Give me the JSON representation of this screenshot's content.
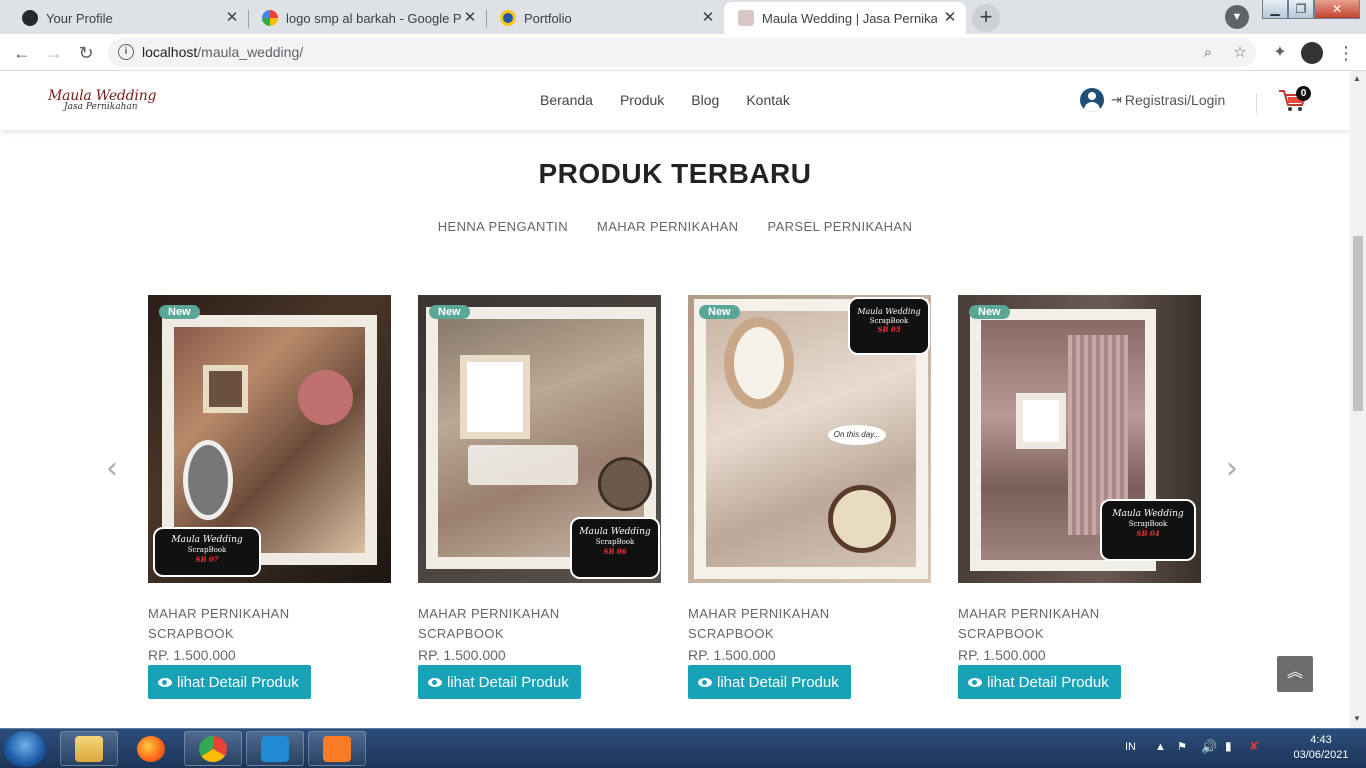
{
  "browser": {
    "tabs": [
      {
        "title": "Your Profile",
        "favicon": "github-icon",
        "color": "#24292e"
      },
      {
        "title": "logo smp al barkah - Google Pen",
        "favicon": "google-icon",
        "color": "#4285f4"
      },
      {
        "title": "Portfolio",
        "favicon": "portfolio-icon",
        "color": "#1e5aa8"
      },
      {
        "title": "Maula Wedding | Jasa Pernikahan",
        "favicon": "site-icon",
        "color": "#a0a0a0"
      }
    ],
    "address": {
      "host": "localhost",
      "path": "/maula_wedding/"
    }
  },
  "site": {
    "logo": {
      "line1": "Maula Wedding",
      "line2": "Jasa Pernikahan"
    },
    "nav": [
      "Beranda",
      "Produk",
      "Blog",
      "Kontak"
    ],
    "account_label": "Registrasi/Login",
    "cart_count": "0",
    "section_title": "PRODUK TERBARU",
    "filters": [
      "HENNA PENGANTIN",
      "MAHAR PERNIKAHAN",
      "PARSEL PERNIKAHAN"
    ],
    "products": [
      {
        "badge": "New",
        "category": "MAHAR PERNIKAHAN",
        "name": "SCRAPBOOK",
        "price": "RP. 1.500.000",
        "button": "lihat Detail Produk",
        "tag": "SB 07"
      },
      {
        "badge": "New",
        "category": "MAHAR PERNIKAHAN",
        "name": "SCRAPBOOK",
        "price": "RP. 1.500.000",
        "button": "lihat Detail Produk",
        "tag": "SB 06"
      },
      {
        "badge": "New",
        "category": "MAHAR PERNIKAHAN",
        "name": "SCRAPBOOK",
        "price": "RP. 1.500.000",
        "button": "lihat Detail Produk",
        "tag": "SB 05"
      },
      {
        "badge": "New",
        "category": "MAHAR PERNIKAHAN",
        "name": "SCRAPBOOK",
        "price": "RP. 1.500.000",
        "button": "lihat Detail Produk",
        "tag": "SB 04"
      }
    ],
    "product_tag_brand": "Maula Wedding",
    "product_tag_sub": "ScrapBook",
    "product_on_this_day": "On this day..."
  },
  "taskbar": {
    "language": "IN",
    "time": "4:43",
    "date": "03/06/2021"
  }
}
